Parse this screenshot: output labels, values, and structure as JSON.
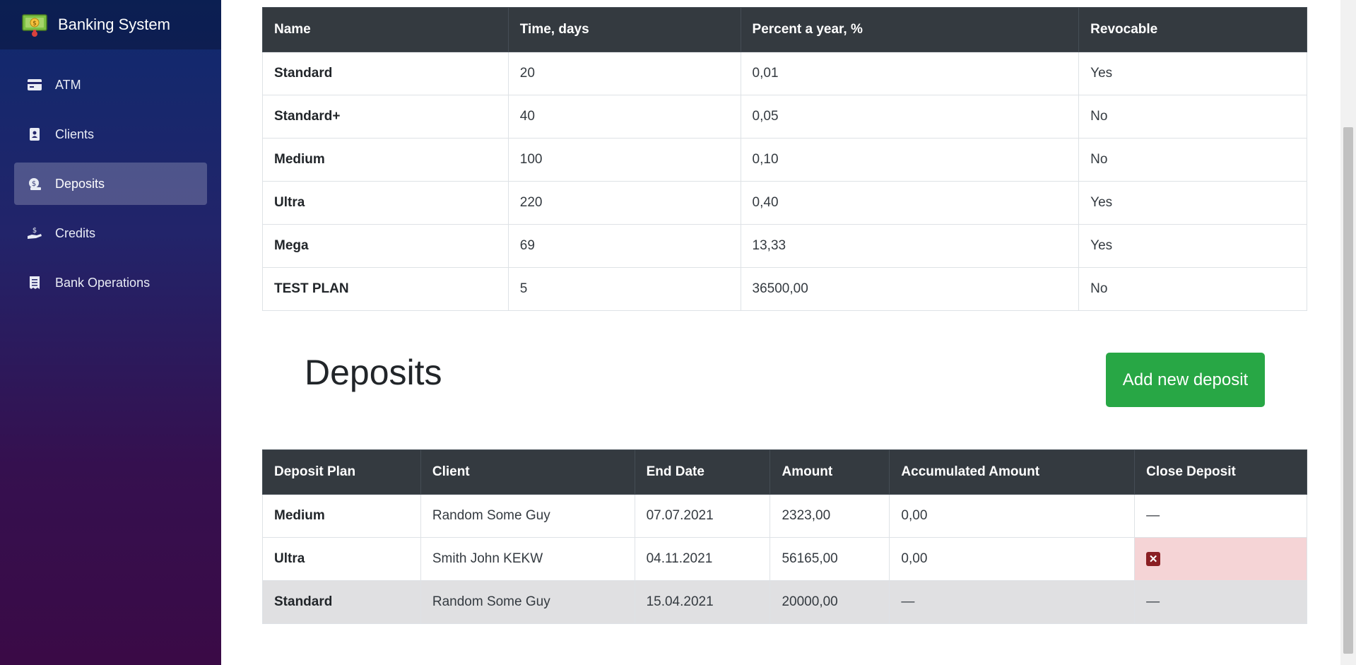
{
  "app": {
    "title": "Banking System"
  },
  "sidebar": {
    "items": [
      {
        "label": "ATM",
        "icon": "credit-card-icon"
      },
      {
        "label": "Clients",
        "icon": "address-book-icon"
      },
      {
        "label": "Deposits",
        "icon": "money-bag-icon",
        "active": true
      },
      {
        "label": "Credits",
        "icon": "hand-holding-dollar-icon"
      },
      {
        "label": "Bank Operations",
        "icon": "receipt-icon"
      }
    ]
  },
  "plans_table": {
    "headers": [
      "Name",
      "Time, days",
      "Percent a year, %",
      "Revocable"
    ],
    "rows": [
      [
        "Standard",
        "20",
        "0,01",
        "Yes"
      ],
      [
        "Standard+",
        "40",
        "0,05",
        "No"
      ],
      [
        "Medium",
        "100",
        "0,10",
        "No"
      ],
      [
        "Ultra",
        "220",
        "0,40",
        "Yes"
      ],
      [
        "Mega",
        "69",
        "13,33",
        "Yes"
      ],
      [
        "TEST PLAN",
        "5",
        "36500,00",
        "No"
      ]
    ]
  },
  "deposits_section": {
    "heading": "Deposits",
    "add_button_label": "Add new deposit"
  },
  "deposits_table": {
    "headers": [
      "Deposit Plan",
      "Client",
      "End Date",
      "Amount",
      "Accumulated Amount",
      "Close Deposit"
    ],
    "rows": [
      [
        "Medium",
        "Random Some Guy",
        "07.07.2021",
        "2323,00",
        "0,00",
        "—"
      ],
      [
        "Ultra",
        "Smith John KEKW",
        "04.11.2021",
        "56165,00",
        "0,00",
        ""
      ],
      [
        "Standard",
        "Random Some Guy",
        "15.04.2021",
        "20000,00",
        "—",
        "—"
      ]
    ]
  },
  "colors": {
    "accent_green": "#28a745",
    "table_header": "#343a40",
    "danger_bg": "#f5d4d6",
    "danger_icon": "#8a1f23"
  }
}
